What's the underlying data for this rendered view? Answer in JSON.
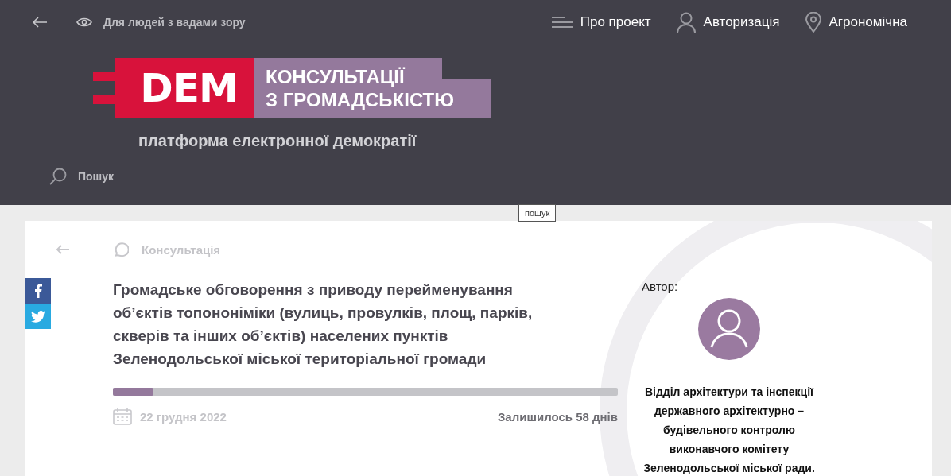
{
  "topbar": {
    "accessibility": "Для людей з вадами зору",
    "menu": [
      {
        "kind": "about",
        "label": "Про проект"
      },
      {
        "kind": "login",
        "label": "Авторизація"
      },
      {
        "kind": "location",
        "label": "Агрономічна"
      }
    ]
  },
  "logo": {
    "mark": "DEM",
    "line1": "КОНСУЛЬТАЦІЇ",
    "line2": "З ГРОМАДСЬКІСТЮ",
    "tagline": "платформа електронної демократії"
  },
  "search": {
    "placeholder": "Пошук",
    "tooltip": "пошук"
  },
  "consultation": {
    "type": "Консультація",
    "title": "Громадське обговорення з приводу перейменування об’єктів топононіміки (вулиць, провулків, площ, парків, скверів та інших об’єктів) населених пунктів Зеленодольської міської територіальної громади",
    "progress": {
      "level": 0.08
    },
    "date": "22 грудня 2022",
    "remaining": "Залишилось 58 днів"
  },
  "author": {
    "label": "Автор:",
    "name": "Відділ архітектури та інспекції державного архітектурно – будівельного контролю виконавчого комітету Зеленодольської міської ради."
  }
}
